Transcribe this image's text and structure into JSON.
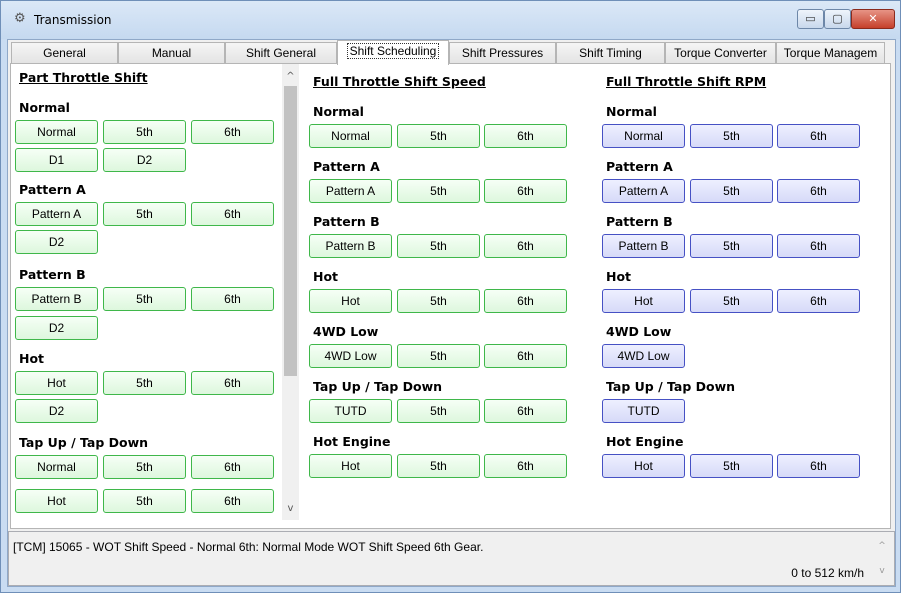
{
  "window": {
    "title": "Transmission",
    "icon": "gear-icon",
    "controls": {
      "minimize": "▭",
      "maximize": "▢",
      "close": "✕"
    }
  },
  "tabs": [
    {
      "label": "General"
    },
    {
      "label": "Manual"
    },
    {
      "label": "Shift General"
    },
    {
      "label": "Shift Scheduling",
      "active": true
    },
    {
      "label": "Shift Pressures"
    },
    {
      "label": "Shift Timing"
    },
    {
      "label": "Torque Converter"
    },
    {
      "label": "Torque Managem"
    }
  ],
  "part_throttle": {
    "title": "Part Throttle Shift",
    "groups": [
      {
        "label": "Normal",
        "buttons": [
          "Normal",
          "5th",
          "6th",
          "D1",
          "D2"
        ]
      },
      {
        "label": "Pattern A",
        "buttons": [
          "Pattern A",
          "5th",
          "6th",
          "D2"
        ]
      },
      {
        "label": "Pattern B",
        "buttons": [
          "Pattern B",
          "5th",
          "6th",
          "D2"
        ]
      },
      {
        "label": "Hot",
        "buttons": [
          "Hot",
          "5th",
          "6th",
          "D2"
        ]
      },
      {
        "label": "Tap Up / Tap Down",
        "buttons": [
          "Normal",
          "5th",
          "6th",
          "Hot",
          "5th",
          "6th"
        ]
      }
    ]
  },
  "full_throttle_speed": {
    "title": "Full Throttle Shift Speed",
    "groups": [
      {
        "label": "Normal",
        "buttons": [
          "Normal",
          "5th",
          "6th"
        ]
      },
      {
        "label": "Pattern A",
        "buttons": [
          "Pattern A",
          "5th",
          "6th"
        ]
      },
      {
        "label": "Pattern B",
        "buttons": [
          "Pattern B",
          "5th",
          "6th"
        ]
      },
      {
        "label": "Hot",
        "buttons": [
          "Hot",
          "5th",
          "6th"
        ]
      },
      {
        "label": "4WD Low",
        "buttons": [
          "4WD Low",
          "5th",
          "6th"
        ]
      },
      {
        "label": "Tap Up / Tap Down",
        "buttons": [
          "TUTD",
          "5th",
          "6th"
        ]
      },
      {
        "label": "Hot Engine",
        "buttons": [
          "Hot",
          "5th",
          "6th"
        ]
      }
    ]
  },
  "full_throttle_rpm": {
    "title": "Full Throttle Shift RPM",
    "groups": [
      {
        "label": "Normal",
        "buttons": [
          "Normal",
          "5th",
          "6th"
        ]
      },
      {
        "label": "Pattern A",
        "buttons": [
          "Pattern A",
          "5th",
          "6th"
        ]
      },
      {
        "label": "Pattern B",
        "buttons": [
          "Pattern B",
          "5th",
          "6th"
        ]
      },
      {
        "label": "Hot",
        "buttons": [
          "Hot",
          "5th",
          "6th"
        ]
      },
      {
        "label": "4WD Low",
        "buttons": [
          "4WD Low"
        ]
      },
      {
        "label": "Tap Up / Tap Down",
        "buttons": [
          "TUTD"
        ]
      },
      {
        "label": "Hot Engine",
        "buttons": [
          "Hot",
          "5th",
          "6th"
        ]
      }
    ]
  },
  "scroll": {
    "up": "^",
    "down": "v"
  },
  "status": {
    "text": "[TCM] 15065 - WOT Shift Speed - Normal 6th: Normal Mode WOT Shift Speed 6th Gear.",
    "range": "0 to 512 km/h",
    "up": "^",
    "down": "v"
  },
  "colors": {
    "green_border": "#3fb74a",
    "green_fill": "#ddf7dd",
    "blue_border": "#4651c4",
    "blue_fill": "#d6daf8"
  }
}
